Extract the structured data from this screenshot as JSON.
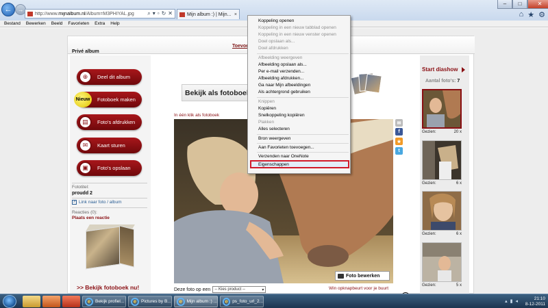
{
  "browser": {
    "address_url_prefix": "http://www.",
    "address_url_domain": "mijnalbum.nl",
    "address_url_rest": "/Album=M3PHIYAL.jpg",
    "tab_title": "Mijn album :) | Mijn...",
    "tab_close": "×",
    "win_min": "–",
    "win_max": "□",
    "win_close": "✕"
  },
  "menubar": [
    "Bestand",
    "Bewerken",
    "Beeld",
    "Favorieten",
    "Extra",
    "Help"
  ],
  "site": {
    "toevoeg_link": "Toevoe",
    "section_title": "Privé album",
    "actions": [
      {
        "label": "Deel dit album",
        "icon": "share-icon"
      },
      {
        "label": "Fotoboek maken",
        "icon": "nieuw-badge",
        "badge": "Nieuw"
      },
      {
        "label": "Foto's afdrukken",
        "icon": "print-icon"
      },
      {
        "label": "Kaart sturen",
        "icon": "card-icon"
      },
      {
        "label": "Foto's opslaan",
        "icon": "save-icon"
      }
    ],
    "fototitel_label": "Fototitel:",
    "fototitel_value": "proudd 2",
    "link_label": "Link naar foto / album",
    "reacties_label": "Reacties (0):",
    "reactie_link": "Plaats een reactie",
    "bekijk_fotoboek_nu": ">> Bekijk fotoboek nu!",
    "banner_text": "Bekijk als fotoboek",
    "in_een_klik": "In één klik als fotoboek",
    "foto_bewerken": "Foto bewerken",
    "deze_foto_op_een": "Deze foto op een",
    "kies_product": "-- Kies product --",
    "win_opknapbeurt": "Win opknapbeurt voor je buurt",
    "start_diashow": "Start diashow",
    "aantal_label": "Aantal foto's:",
    "aantal_value": "7",
    "thumbs": [
      {
        "views_label": "Gezien:",
        "views": "20 x"
      },
      {
        "views_label": "Gezien:",
        "views": "6 x"
      },
      {
        "views_label": "Gezien:",
        "views": "6 x"
      },
      {
        "views_label": "Gezien:",
        "views": "5 x"
      }
    ]
  },
  "context_menu": {
    "items": [
      {
        "label": "Koppeling openen",
        "enabled": true
      },
      {
        "label": "Koppeling in een nieuw tabblad openen",
        "enabled": false
      },
      {
        "label": "Koppeling in een nieuw venster openen",
        "enabled": false
      },
      {
        "label": "Doel opslaan als...",
        "enabled": false
      },
      {
        "label": "Doel afdrukken",
        "enabled": false
      },
      {
        "label": "Afbeelding weergeven",
        "enabled": false
      },
      {
        "label": "Afbeelding opslaan als...",
        "enabled": true
      },
      {
        "label": "Per e-mail verzenden...",
        "enabled": true
      },
      {
        "label": "Afbeelding afdrukken...",
        "enabled": true
      },
      {
        "label": "Ga naar Mijn afbeeldingen",
        "enabled": true
      },
      {
        "label": "Als achtergrond gebruiken",
        "enabled": true
      },
      {
        "label": "Knippen",
        "enabled": false
      },
      {
        "label": "Kopiëren",
        "enabled": true
      },
      {
        "label": "Snelkoppeling kopiëren",
        "enabled": true
      },
      {
        "label": "Plakken",
        "enabled": false
      },
      {
        "label": "Alles selecteren",
        "enabled": true
      },
      {
        "label": "Bron weergeven",
        "enabled": true
      },
      {
        "label": "Aan Favorieten toevoegen...",
        "enabled": true
      },
      {
        "label": "Verzenden naar OneNote",
        "enabled": true
      },
      {
        "label": "Eigenschappen",
        "enabled": true,
        "highlighted": true
      }
    ],
    "highlight_color": "#d11a2a"
  },
  "taskbar": {
    "tasks": [
      "Bekijk profiel...",
      "Pictures by B...",
      "Mijn album :) ...",
      "ps_foto_url_2..."
    ],
    "time": "21:10",
    "date": "8-12-2011"
  },
  "colors": {
    "brand_red": "#8a0f13",
    "link_blue": "#2c5f95"
  }
}
